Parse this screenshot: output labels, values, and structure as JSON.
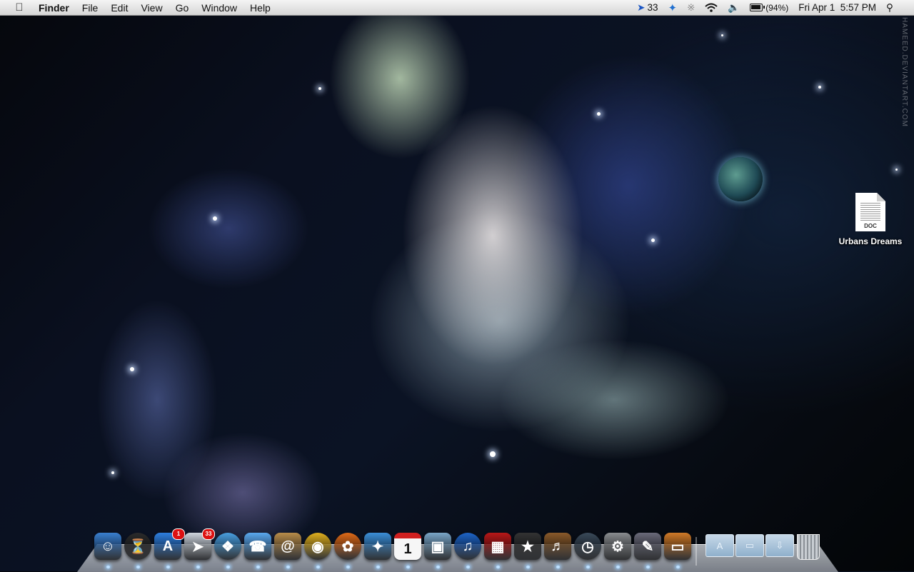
{
  "menubar": {
    "apple_icon": "apple-logo-icon",
    "app_name": "Finder",
    "menus": [
      "File",
      "Edit",
      "View",
      "Go",
      "Window",
      "Help"
    ],
    "extras": {
      "sparrow_count": "33",
      "battery_percent_label": "(94%)",
      "battery_level": 0.94,
      "datetime": "Fri Apr 1  5:57 PM"
    }
  },
  "desktop": {
    "file": {
      "name": "Urbans Dreams",
      "type_badge": "DOC"
    },
    "watermark": "HAMEED.DEVIANTART.COM"
  },
  "dock": {
    "apps": [
      {
        "name": "Finder",
        "icon": "finder-icon",
        "color": "#3a7fd0"
      },
      {
        "name": "Dashboard",
        "icon": "dashboard-icon",
        "color": "#2b2b2b"
      },
      {
        "name": "App Store",
        "icon": "app-store-icon",
        "color": "#2e7fe0",
        "badge": "1"
      },
      {
        "name": "Sparrow",
        "icon": "sparrow-icon",
        "color": "#cfd6de",
        "badge": "33"
      },
      {
        "name": "Safari",
        "icon": "safari-icon",
        "color": "#4aa0e0"
      },
      {
        "name": "iChat",
        "icon": "ichat-icon",
        "color": "#5aa8ee"
      },
      {
        "name": "Address Book",
        "icon": "address-book-icon",
        "color": "#b88c4a"
      },
      {
        "name": "Chrome",
        "icon": "chrome-icon",
        "color": "#e0b020"
      },
      {
        "name": "Firefox",
        "icon": "firefox-icon",
        "color": "#e06a18"
      },
      {
        "name": "Twitter",
        "icon": "twitter-icon",
        "color": "#3c8fd8"
      },
      {
        "name": "iCal",
        "icon": "ical-icon",
        "color": "#f2f2f2",
        "label": "1"
      },
      {
        "name": "iPhoto",
        "icon": "iphoto-icon",
        "color": "#7aa6c8"
      },
      {
        "name": "iTunes",
        "icon": "itunes-icon",
        "color": "#1e64c8"
      },
      {
        "name": "Photo Booth",
        "icon": "photo-booth-icon",
        "color": "#b81818"
      },
      {
        "name": "iMovie",
        "icon": "imovie-icon",
        "color": "#333"
      },
      {
        "name": "GarageBand",
        "icon": "garageband-icon",
        "color": "#8a5a2a"
      },
      {
        "name": "Time Machine",
        "icon": "time-machine-icon",
        "color": "#3a4a5a"
      },
      {
        "name": "System Preferences",
        "icon": "system-preferences-icon",
        "color": "#8a8d90"
      },
      {
        "name": "Script Editor",
        "icon": "script-editor-icon",
        "color": "#6a6a7a"
      },
      {
        "name": "Keynote",
        "icon": "keynote-icon",
        "color": "#d07a28"
      }
    ],
    "stacks": [
      {
        "name": "Applications",
        "icon": "applications-folder-icon"
      },
      {
        "name": "Documents",
        "icon": "documents-folder-icon"
      },
      {
        "name": "Downloads",
        "icon": "downloads-folder-icon"
      }
    ],
    "trash": {
      "name": "Trash",
      "icon": "trash-icon"
    }
  }
}
